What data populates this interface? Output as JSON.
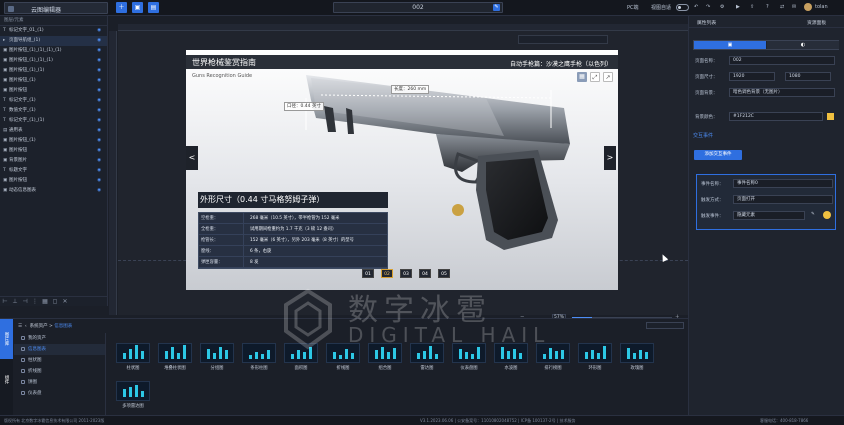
{
  "app": {
    "title": "云图编辑器",
    "project_name": "002",
    "device": "PC端",
    "preview_label": "视图自适",
    "user": "tolan"
  },
  "layers": {
    "header": "图层/元素",
    "items": [
      {
        "icon": "T",
        "label": "标记文字_01_(1)"
      },
      {
        "icon": "▸",
        "label": "页面导航组_(1)"
      },
      {
        "icon": "▣",
        "label": "图片按钮_(1)_(1)_(1)_(1)"
      },
      {
        "icon": "▣",
        "label": "图片按钮_(1)_(1)_(1)"
      },
      {
        "icon": "▣",
        "label": "图片按钮_(1)_(1)"
      },
      {
        "icon": "▣",
        "label": "图片按钮_(1)"
      },
      {
        "icon": "▣",
        "label": "图片按钮"
      },
      {
        "icon": "T",
        "label": "标记文字_(1)"
      },
      {
        "icon": "T",
        "label": "数值文字_(1)"
      },
      {
        "icon": "T",
        "label": "标记文字_(1)_(1)"
      },
      {
        "icon": "▤",
        "label": "通用表"
      },
      {
        "icon": "▣",
        "label": "图片按钮_(1)"
      },
      {
        "icon": "▣",
        "label": "图片按钮"
      },
      {
        "icon": "▣",
        "label": "背景图片"
      },
      {
        "icon": "T",
        "label": "标题文字"
      },
      {
        "icon": "▣",
        "label": "图片按钮"
      },
      {
        "icon": "▣",
        "label": "动态信息图表"
      }
    ]
  },
  "stage": {
    "title": "世界枪械鉴赏指南",
    "subtitle": "Guns Recognition Guide",
    "model": "自动手枪篇：沙漠之鹰手枪（以色列）",
    "len_tag": "长度：260 mm",
    "bore_tag": "口径：0.44 英寸",
    "section": "外形尺寸（0.44 寸马格努姆子弹）",
    "specs": [
      {
        "k": "空枪重：",
        "v": "268 毫米（10.5 英寸），带半枪管为 152 毫米"
      },
      {
        "k": "全枪重：",
        "v": "试用期间枪重约为 1.7 千克（3 磅 12 盎司）"
      },
      {
        "k": "枪管长：",
        "v": "152 毫米（6 英寸），另外 203 毫米（8 英寸）的型号"
      },
      {
        "k": "膛线：",
        "v": "6 条，右旋"
      },
      {
        "k": "弹匣容量：",
        "v": "8 发"
      }
    ],
    "pages": [
      "01",
      "02",
      "03",
      "04",
      "05"
    ],
    "active_page": "02"
  },
  "zoom": {
    "value": "57%"
  },
  "assets": {
    "tabs": [
      "图片库",
      "组件"
    ],
    "breadcrumb_root": "系统资产",
    "breadcrumb_current": "信息图表",
    "categories": [
      "我的资产",
      "信息图表",
      "柱状图",
      "折线图",
      "饼图",
      "仪表盘"
    ],
    "tiles": [
      "柱状图",
      "堆叠柱状图",
      "分组图",
      "条形柱图",
      "面积图",
      "折线图",
      "组合图",
      "雷达图",
      "仪表盘图",
      "水波图",
      "排行榜图",
      "环形图",
      "玫瑰图",
      "多项雷达图"
    ]
  },
  "props": {
    "tab_left": "属性列表",
    "tab_right": "资源面板",
    "page_name_label": "页面名称：",
    "page_name": "002",
    "page_size_label": "页面尺寸：",
    "width": "1920",
    "height": "1080",
    "bg_label": "页面背景：",
    "bg_value": "暗色调色背景（无图片）",
    "bgcolor_label": "背景颜色：",
    "bgcolor": "#1F212C",
    "events_title": "交互事件",
    "add_event": "添加交互事件",
    "ev_name_label": "事件名称：",
    "ev_name": "事件名称0",
    "ev_trigger_label": "触发方式：",
    "ev_trigger": "页面打开",
    "ev_action_label": "触发事件：",
    "ev_action": "隐藏元素"
  },
  "footer": {
    "left": "版权所有 北京数字冰雹信息技术有限公司 2011-2023版",
    "mid": "V3.1.2023.06.06 | 公安备案号：11010802048752 | ICP备 100137-2号 | 技术服务",
    "right": "客服电话：400-818-7866"
  },
  "watermark": {
    "cn": "数字冰雹",
    "en": "DIGITAL HAIL"
  }
}
